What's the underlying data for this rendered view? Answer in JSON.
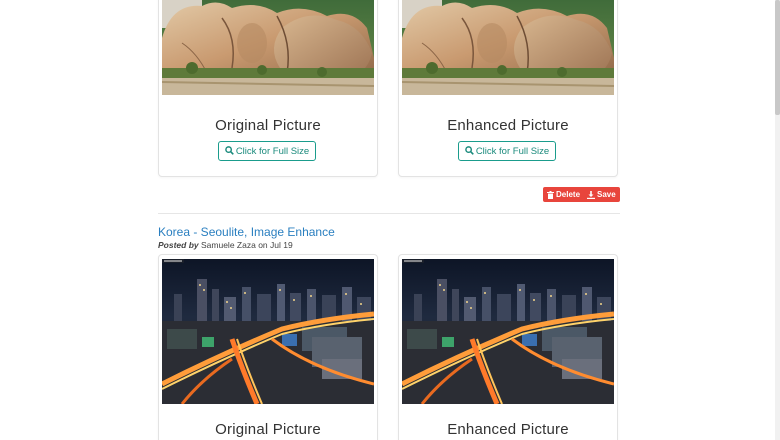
{
  "top_post": {
    "original": {
      "caption": "Original Picture",
      "button": "Click for Full Size",
      "image": "boulder-rock-photo"
    },
    "enhanced": {
      "caption": "Enhanced Picture",
      "button": "Click for Full Size",
      "image": "boulder-rock-photo"
    },
    "actions": {
      "delete_label": "Delete",
      "save_label": "Save"
    }
  },
  "second_post": {
    "title": "Korea - Seoulite, Image Enhance",
    "posted_by_label": "Posted by",
    "author": "Samuele Zaza",
    "on_label": "on",
    "date": "Jul 19",
    "original": {
      "caption": "Original Picture",
      "image": "seoul-night-cityscape-photo"
    },
    "enhanced": {
      "caption": "Enhanced Picture",
      "image": "seoul-night-cityscape-photo"
    }
  },
  "colors": {
    "link_blue": "#2a7fc0",
    "button_teal": "#1a9c8c",
    "danger_red": "#e8453c"
  }
}
